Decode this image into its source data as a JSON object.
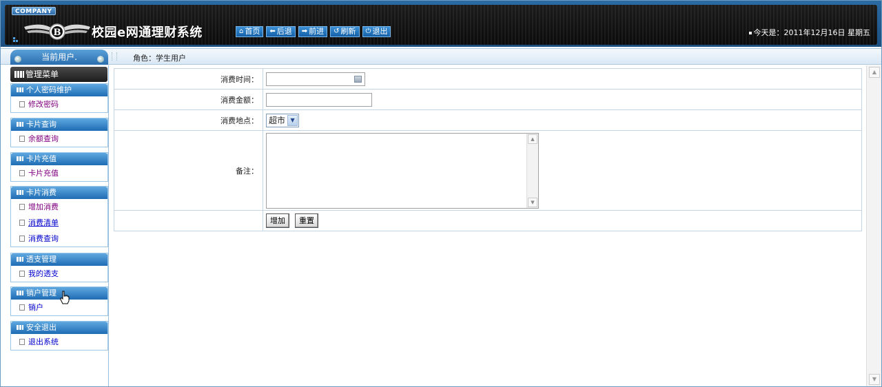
{
  "header": {
    "company_tag": "COMPANY",
    "app_title": "校园e网通理财系统",
    "nav": [
      {
        "label": "首页",
        "icon": "home-icon",
        "glyph": "⌂"
      },
      {
        "label": "后退",
        "icon": "back-arrow-icon",
        "glyph": "◆"
      },
      {
        "label": "前进",
        "icon": "forward-arrow-icon",
        "glyph": "➡"
      },
      {
        "label": "刷新",
        "icon": "refresh-icon",
        "glyph": "↺"
      },
      {
        "label": "退出",
        "icon": "power-icon",
        "glyph": "⏻"
      }
    ],
    "date_text": "今天是：2011年12月16日 星期五"
  },
  "subbar": {
    "current_user_label": "当前用户.",
    "role_text": "角色：学生用户"
  },
  "sidebar": {
    "menu_title": "管理菜单",
    "groups": [
      {
        "title": "个人密码维护",
        "items": [
          {
            "label": "修改密码"
          }
        ]
      },
      {
        "title": "卡片查询",
        "items": [
          {
            "label": "余额查询"
          }
        ]
      },
      {
        "title": "卡片充值",
        "items": [
          {
            "label": "卡片充值"
          }
        ]
      },
      {
        "title": "卡片消费",
        "items": [
          {
            "label": "增加消费"
          },
          {
            "label": "消费清单"
          },
          {
            "label": "消费查询"
          }
        ]
      },
      {
        "title": "透支管理",
        "items": [
          {
            "label": "我的透支"
          }
        ]
      },
      {
        "title": "销户管理",
        "items": [
          {
            "label": "销户"
          }
        ]
      },
      {
        "title": "安全退出",
        "items": [
          {
            "label": "退出系统"
          }
        ]
      }
    ]
  },
  "form": {
    "time_label": "消费时间：",
    "time_value": "",
    "amount_label": "消费金额：",
    "amount_value": "",
    "place_label": "消费地点：",
    "place_selected": "超市",
    "remark_label": "备注：",
    "remark_value": "",
    "add_button": "增加",
    "reset_button": "重置"
  },
  "colors": {
    "header_bg": "#0b0b0b",
    "accent": "#1e6cb4",
    "visited_link": "#800080",
    "link": "#0000cc"
  }
}
